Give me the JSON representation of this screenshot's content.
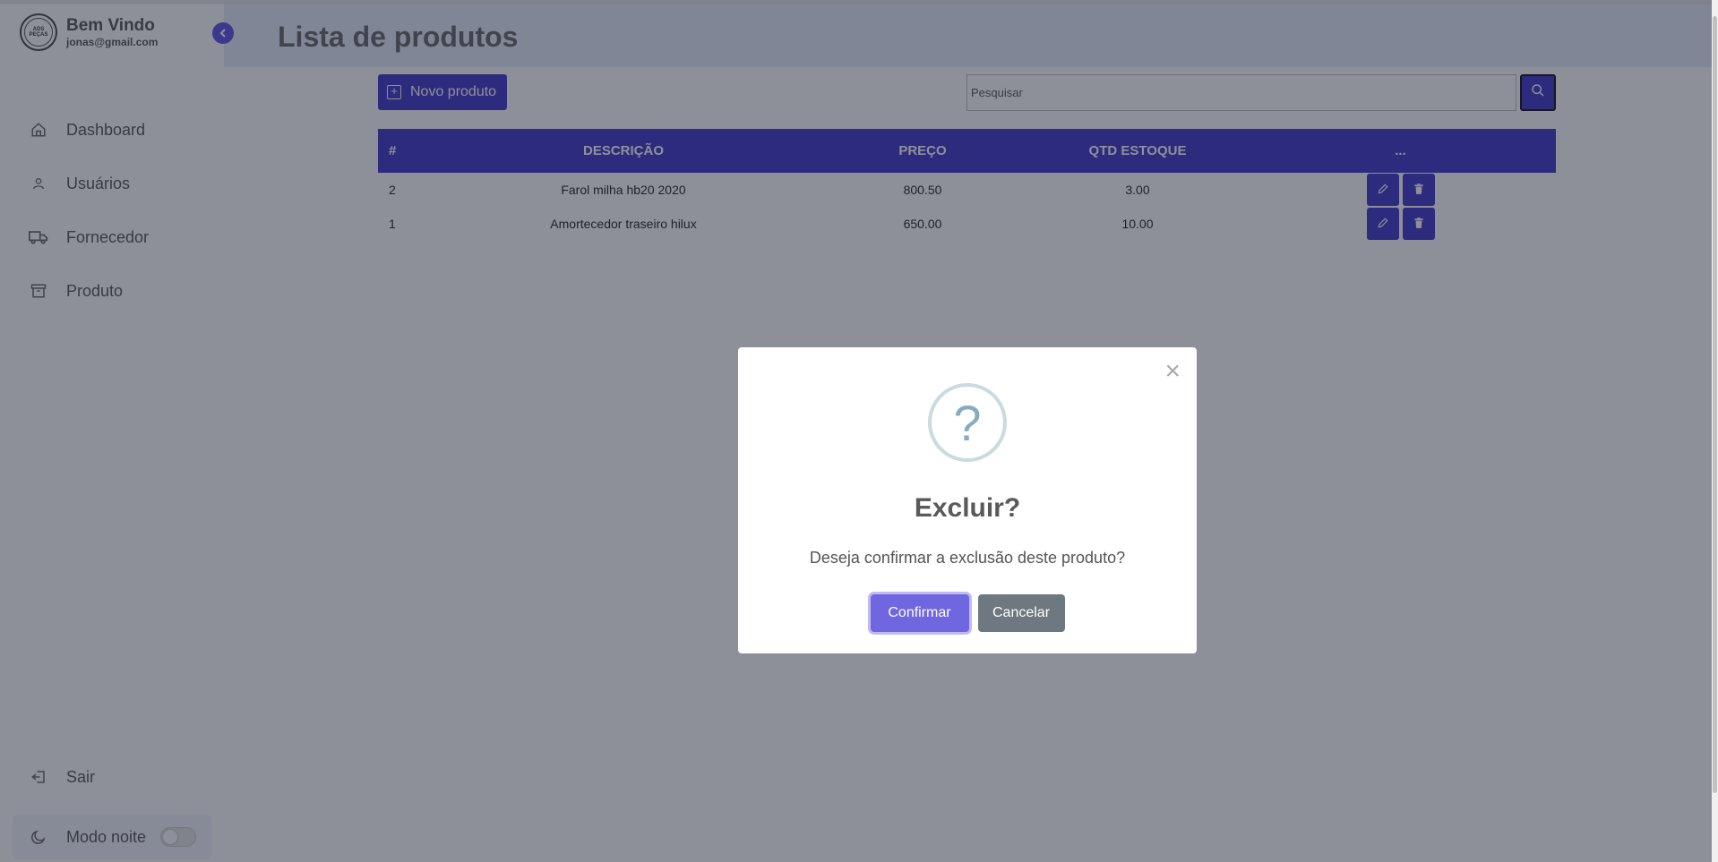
{
  "sidebar": {
    "logo_text": "ADS PEÇAS",
    "title": "Bem Vindo",
    "email": "jonas@gmail.com",
    "items": [
      {
        "label": "Dashboard",
        "icon": "home-icon"
      },
      {
        "label": "Usuários",
        "icon": "user-icon"
      },
      {
        "label": "Fornecedor",
        "icon": "truck-icon"
      },
      {
        "label": "Produto",
        "icon": "archive-icon"
      }
    ],
    "logout_label": "Sair",
    "night_mode_label": "Modo noite",
    "night_mode_on": false
  },
  "header": {
    "title": "Lista de produtos"
  },
  "toolbar": {
    "new_label": "Novo produto",
    "search_placeholder": "Pesquisar",
    "search_value": ""
  },
  "table": {
    "columns": [
      "#",
      "DESCRIÇÃO",
      "PREÇO",
      "QTD ESTOQUE",
      "..."
    ],
    "rows": [
      {
        "id": "2",
        "descricao": "Farol milha hb20 2020",
        "preco": "800.50",
        "qtd": "3.00"
      },
      {
        "id": "1",
        "descricao": "Amortecedor traseiro hilux",
        "preco": "650.00",
        "qtd": "10.00"
      }
    ]
  },
  "modal": {
    "icon": "question-icon",
    "title": "Excluir?",
    "text": "Deseja confirmar a exclusão deste produto?",
    "confirm_label": "Confirmar",
    "cancel_label": "Cancelar",
    "close_symbol": "×"
  },
  "colors": {
    "primary": "#3f35c9",
    "confirm": "#7066e0",
    "cancel": "#6e7881",
    "header_bg": "#e5eaf8"
  }
}
